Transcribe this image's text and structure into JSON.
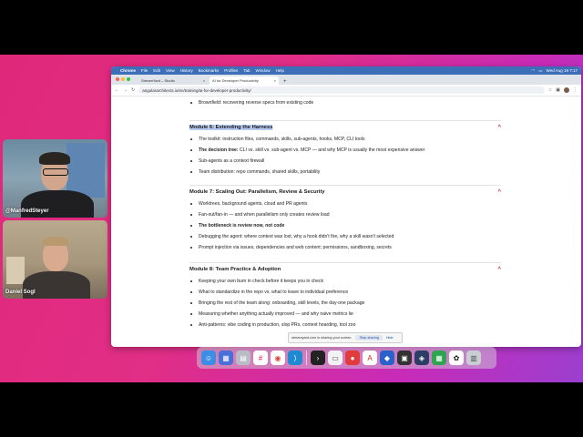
{
  "participants": [
    {
      "name": "@ManfredSteyer"
    },
    {
      "name": "Daniel Sogl"
    }
  ],
  "menubar": {
    "app": "Chrome",
    "items": [
      "File",
      "Edit",
      "View",
      "History",
      "Bookmarks",
      "Profiles",
      "Tab",
      "Window",
      "Help"
    ],
    "clock": "Wed Aug 19  7:17"
  },
  "tabs": [
    {
      "label": "StreamYard – Studio",
      "active": false
    },
    {
      "label": "AI for Developer Productivity",
      "active": true
    }
  ],
  "address_bar": {
    "url": "angulararchitects.io/en/training/ai-for-developer-productivity/"
  },
  "page": {
    "intro_items": [
      {
        "text": "Brownfield: recovering reverse specs from existing code"
      }
    ],
    "modules": [
      {
        "title": "Module 6: Extending the Harness",
        "selected": true,
        "items": [
          {
            "text": "The toolkit: instruction files, commands, skills, sub-agents, hooks, MCP, CLI tools"
          },
          {
            "bold": "The decision tree:",
            "text": " CLI vs. skill vs. sub-agent vs. MCP — and why MCP is usually the most expensive answer"
          },
          {
            "text": "Sub-agents as a context firewall"
          },
          {
            "text": "Team distribution: repo commands, shared skills, portability"
          }
        ]
      },
      {
        "title": "Module 7: Scaling Out: Parallelism, Review & Security",
        "selected": false,
        "items": [
          {
            "text": "Worktrees, background agents, cloud and PR agents"
          },
          {
            "text": "Fan-out/fan-in — and when parallelism only creates review load"
          },
          {
            "bold": "The bottleneck is review now, not code",
            "text": ""
          },
          {
            "text": "Debugging the agent: where context was lost, why a hook didn't fire, why a skill wasn't selected"
          },
          {
            "text": "Prompt injection via issues, dependencies and web content; permissions, sandboxing, secrets"
          }
        ]
      },
      {
        "title": "Module 8: Team Practice & Adoption",
        "selected": false,
        "items": [
          {
            "text": "Keeping your own burn in check before it keeps you in check"
          },
          {
            "text": "What to standardize in the repo vs. what to leave to individual preference"
          },
          {
            "text": "Bringing the rest of the team along: onboarding, skill levels, the day-one package"
          },
          {
            "text": "Measuring whether anything actually improved — and why naive metrics lie"
          },
          {
            "text": "Anti-patterns: vibe coding in production, slop PRs, context hoarding, tool zoo"
          }
        ]
      }
    ]
  },
  "share_bar": {
    "message": "streamyard.com is sharing your screen.",
    "stop_label": "Stop sharing",
    "hide_label": "Hide"
  },
  "dock_icons": [
    "finder-icon",
    "launchpad-icon",
    "calendar-icon",
    "slack-icon",
    "chrome-icon",
    "vscode-icon",
    "terminal-icon",
    "notes-icon",
    "app-icon-red",
    "acrobat-icon",
    "app-icon-blue",
    "app-icon-dark",
    "app-icon-navy",
    "app-icon-green",
    "chatgpt-icon",
    "trash-icon"
  ],
  "colors": {
    "accent": "#c0262d",
    "selection": "#b9cdf2",
    "menubar": "#3c6fb8"
  }
}
